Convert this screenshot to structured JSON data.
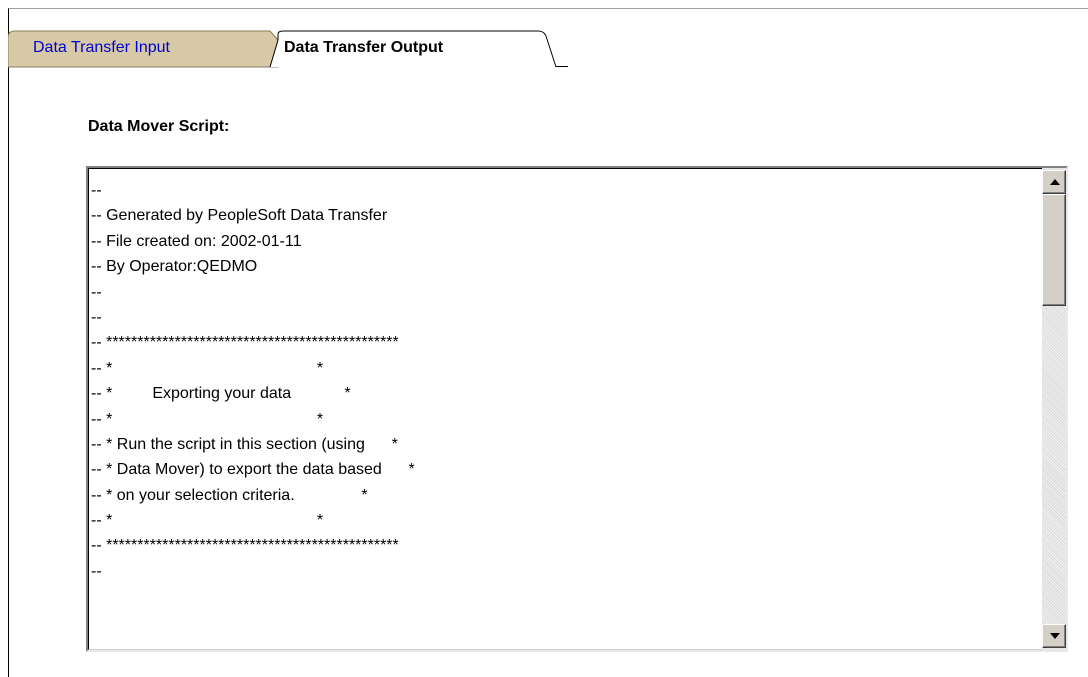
{
  "tabs": [
    {
      "label": "Data Transfer Input",
      "active": false,
      "link_color": "#0000cc",
      "tab_bg": "#d8c9a6"
    },
    {
      "label": "Data Transfer Output",
      "active": true
    }
  ],
  "section": {
    "label": "Data Mover Script:"
  },
  "script": {
    "lines": [
      "--",
      "-- Generated by PeopleSoft Data Transfer",
      "-- File created on: 2002-01-11",
      "-- By Operator:QEDMO",
      "--",
      "--",
      "-- ***********************************************",
      "-- *                                              *",
      "-- *         Exporting your data            *",
      "-- *                                              *",
      "-- * Run the script in this section (using      *",
      "-- * Data Mover) to export the data based      *",
      "-- * on your selection criteria.               *",
      "-- *                                              *",
      "-- ***********************************************",
      "--"
    ]
  },
  "icons": {
    "scroll_up": "scroll-up-arrow-icon",
    "scroll_down": "scroll-down-arrow-icon"
  }
}
